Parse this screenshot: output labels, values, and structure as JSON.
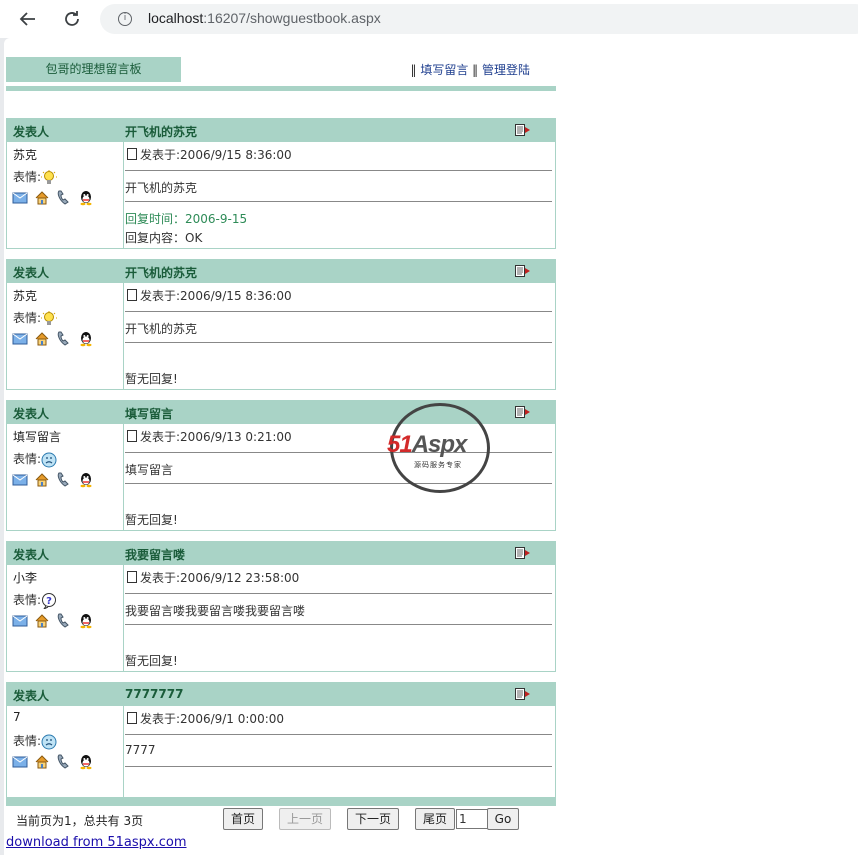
{
  "browser": {
    "url_host": "localhost",
    "url_rest": ":16207/showguestbook.aspx"
  },
  "header": {
    "tab_label": "包哥的理想留言板",
    "sep1": "‖",
    "link_write": "填写留言",
    "sep2": "‖",
    "link_admin": "管理登陆"
  },
  "labels": {
    "author_col": "发表人",
    "mood": "表情:",
    "posted_prefix": "发表于:",
    "reply_time_prefix": "回复时间：",
    "reply_content_prefix": "回复内容：",
    "no_reply": "暂无回复!"
  },
  "messages": [
    {
      "title": "开飞机的苏克",
      "author": "苏克",
      "mood_icon": "lightbulb-icon",
      "posted": "2006/9/15 8:36:00",
      "text": "开飞机的苏克",
      "reply_time": "2006-9-15",
      "reply_content": "OK"
    },
    {
      "title": "开飞机的苏克",
      "author": "苏克",
      "mood_icon": "lightbulb-icon",
      "posted": "2006/9/15 8:36:00",
      "text": "开飞机的苏克"
    },
    {
      "title": "填写留言",
      "author": "填写留言",
      "mood_icon": "sad-face-icon",
      "posted": "2006/9/13 0:21:00",
      "text": "填写留言"
    },
    {
      "title": "我要留言喽",
      "author": "小李",
      "mood_icon": "question-icon",
      "posted": "2006/9/12 23:58:00",
      "text": "我要留言喽我要留言喽我要留言喽"
    },
    {
      "title": "7777777",
      "author": "7",
      "mood_icon": "sad-face-icon",
      "posted": "2006/9/1 0:00:00",
      "text": "7777"
    }
  ],
  "pager": {
    "status": "当前页为1，总共有 3页",
    "first": "首页",
    "prev": "上一页",
    "next": "下一页",
    "last": "尾页",
    "page_value": "1",
    "go": "Go"
  },
  "footer": {
    "download": "download from 51aspx.com"
  },
  "watermark": {
    "brand_red": "51",
    "brand_gray": "Aspx",
    "tagline": "源码服务专家"
  },
  "colors": {
    "header_bg": "#a9d3c6",
    "header_text": "#1a5c3a",
    "reply_green": "#2e8b57"
  }
}
